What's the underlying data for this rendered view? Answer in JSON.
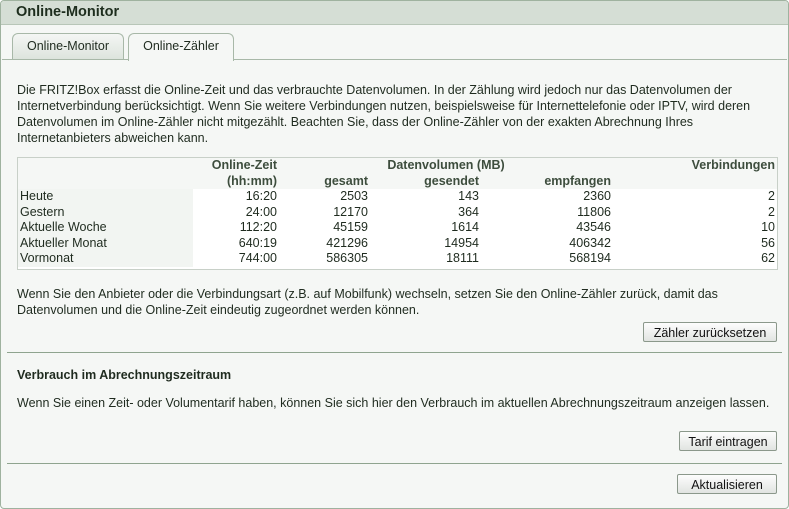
{
  "window": {
    "title": "Online-Monitor"
  },
  "tabs": [
    {
      "label": "Online-Monitor",
      "active": false
    },
    {
      "label": "Online-Zähler",
      "active": true
    }
  ],
  "intro": "Die FRITZ!Box erfasst die Online-Zeit und das verbrauchte Datenvolumen. In der Zählung wird jedoch nur das Datenvolumen der Internetverbindung berücksichtigt. Wenn Sie weitere Verbindungen nutzen, beispielsweise für Internettelefonie oder IPTV, wird deren Datenvolumen im Online-Zähler nicht mitgezählt. Beachten Sie, dass der Online-Zähler von der exakten Abrechnung Ihres Internetanbieters abweichen kann.",
  "table": {
    "header1": {
      "online_time": "Online-Zeit",
      "data_volume": "Datenvolumen (MB)",
      "connections": "Verbindungen"
    },
    "header2": {
      "online_time_unit": "(hh:mm)",
      "total": "gesamt",
      "sent": "gesendet",
      "received": "empfangen"
    },
    "rows": [
      {
        "label": "Heute",
        "time": "16:20",
        "total": "2503",
        "sent": "143",
        "received": "2360",
        "connections": "2"
      },
      {
        "label": "Gestern",
        "time": "24:00",
        "total": "12170",
        "sent": "364",
        "received": "11806",
        "connections": "2"
      },
      {
        "label": "Aktuelle Woche",
        "time": "112:20",
        "total": "45159",
        "sent": "1614",
        "received": "43546",
        "connections": "10"
      },
      {
        "label": "Aktueller Monat",
        "time": "640:19",
        "total": "421296",
        "sent": "14954",
        "received": "406342",
        "connections": "56"
      },
      {
        "label": "Vormonat",
        "time": "744:00",
        "total": "586305",
        "sent": "18111",
        "received": "568194",
        "connections": "62"
      }
    ]
  },
  "reset_note": "Wenn Sie den Anbieter oder die Verbindungsart (z.B. auf Mobilfunk) wechseln, setzen Sie den Online-Zähler zurück, damit das Datenvolumen und die Online-Zeit eindeutig zugeordnet werden können.",
  "reset_button": "Zähler zurücksetzen",
  "billing": {
    "title": "Verbrauch im Abrechnungszeitraum",
    "text": "Wenn Sie einen Zeit- oder Volumentarif haben, können Sie sich hier den Verbrauch im aktuellen Abrechnungszeitraum anzeigen lassen.",
    "button": "Tarif eintragen"
  },
  "refresh_button": "Aktualisieren"
}
